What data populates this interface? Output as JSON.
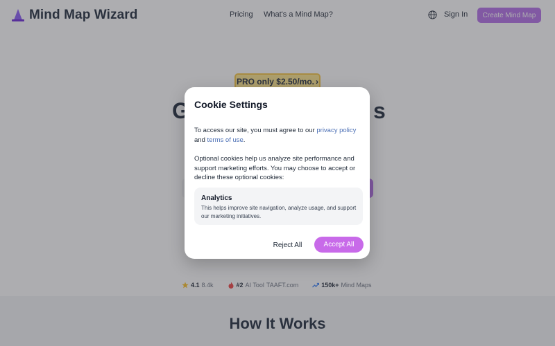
{
  "header": {
    "logo_text": "Mind Map Wizard",
    "nav": [
      "Pricing",
      "What's a Mind Map?"
    ],
    "sign_in": "Sign In",
    "create_button": "Create Mind Map"
  },
  "hero": {
    "pro_badge": "PRO only $2.50/mo.",
    "pro_badge_arrow": "›",
    "title_left": "G",
    "title_right": "s"
  },
  "stats": {
    "rating": "4.1",
    "rating_count": "8.4k",
    "rank": "#2",
    "rank_label": "AI Tool",
    "rank_source": "TAAFT.com",
    "maps": "150k+",
    "maps_label": "Mind Maps"
  },
  "section": {
    "how_title": "How It Works"
  },
  "modal": {
    "title": "Cookie Settings",
    "p1_before": "To access our site, you must agree to our ",
    "privacy_link": "privacy policy",
    "p1_mid": " and ",
    "terms_link": "terms of use",
    "p1_after": ".",
    "p2": "Optional cookies help us analyze site performance and support marketing efforts. You may choose to accept or decline these optional cookies:",
    "analytics_title": "Analytics",
    "analytics_desc": "This helps improve site navigation, analyze usage, and support our marketing initiatives.",
    "reject": "Reject All",
    "accept": "Accept All"
  },
  "colors": {
    "accent": "#b46ee8",
    "accept": "#c86ae9",
    "link": "#4b6fb5",
    "badge": "#fde68a"
  },
  "icons": [
    "wizard-hat-icon",
    "globe-icon",
    "star-icon",
    "flame-icon",
    "trend-up-icon"
  ]
}
